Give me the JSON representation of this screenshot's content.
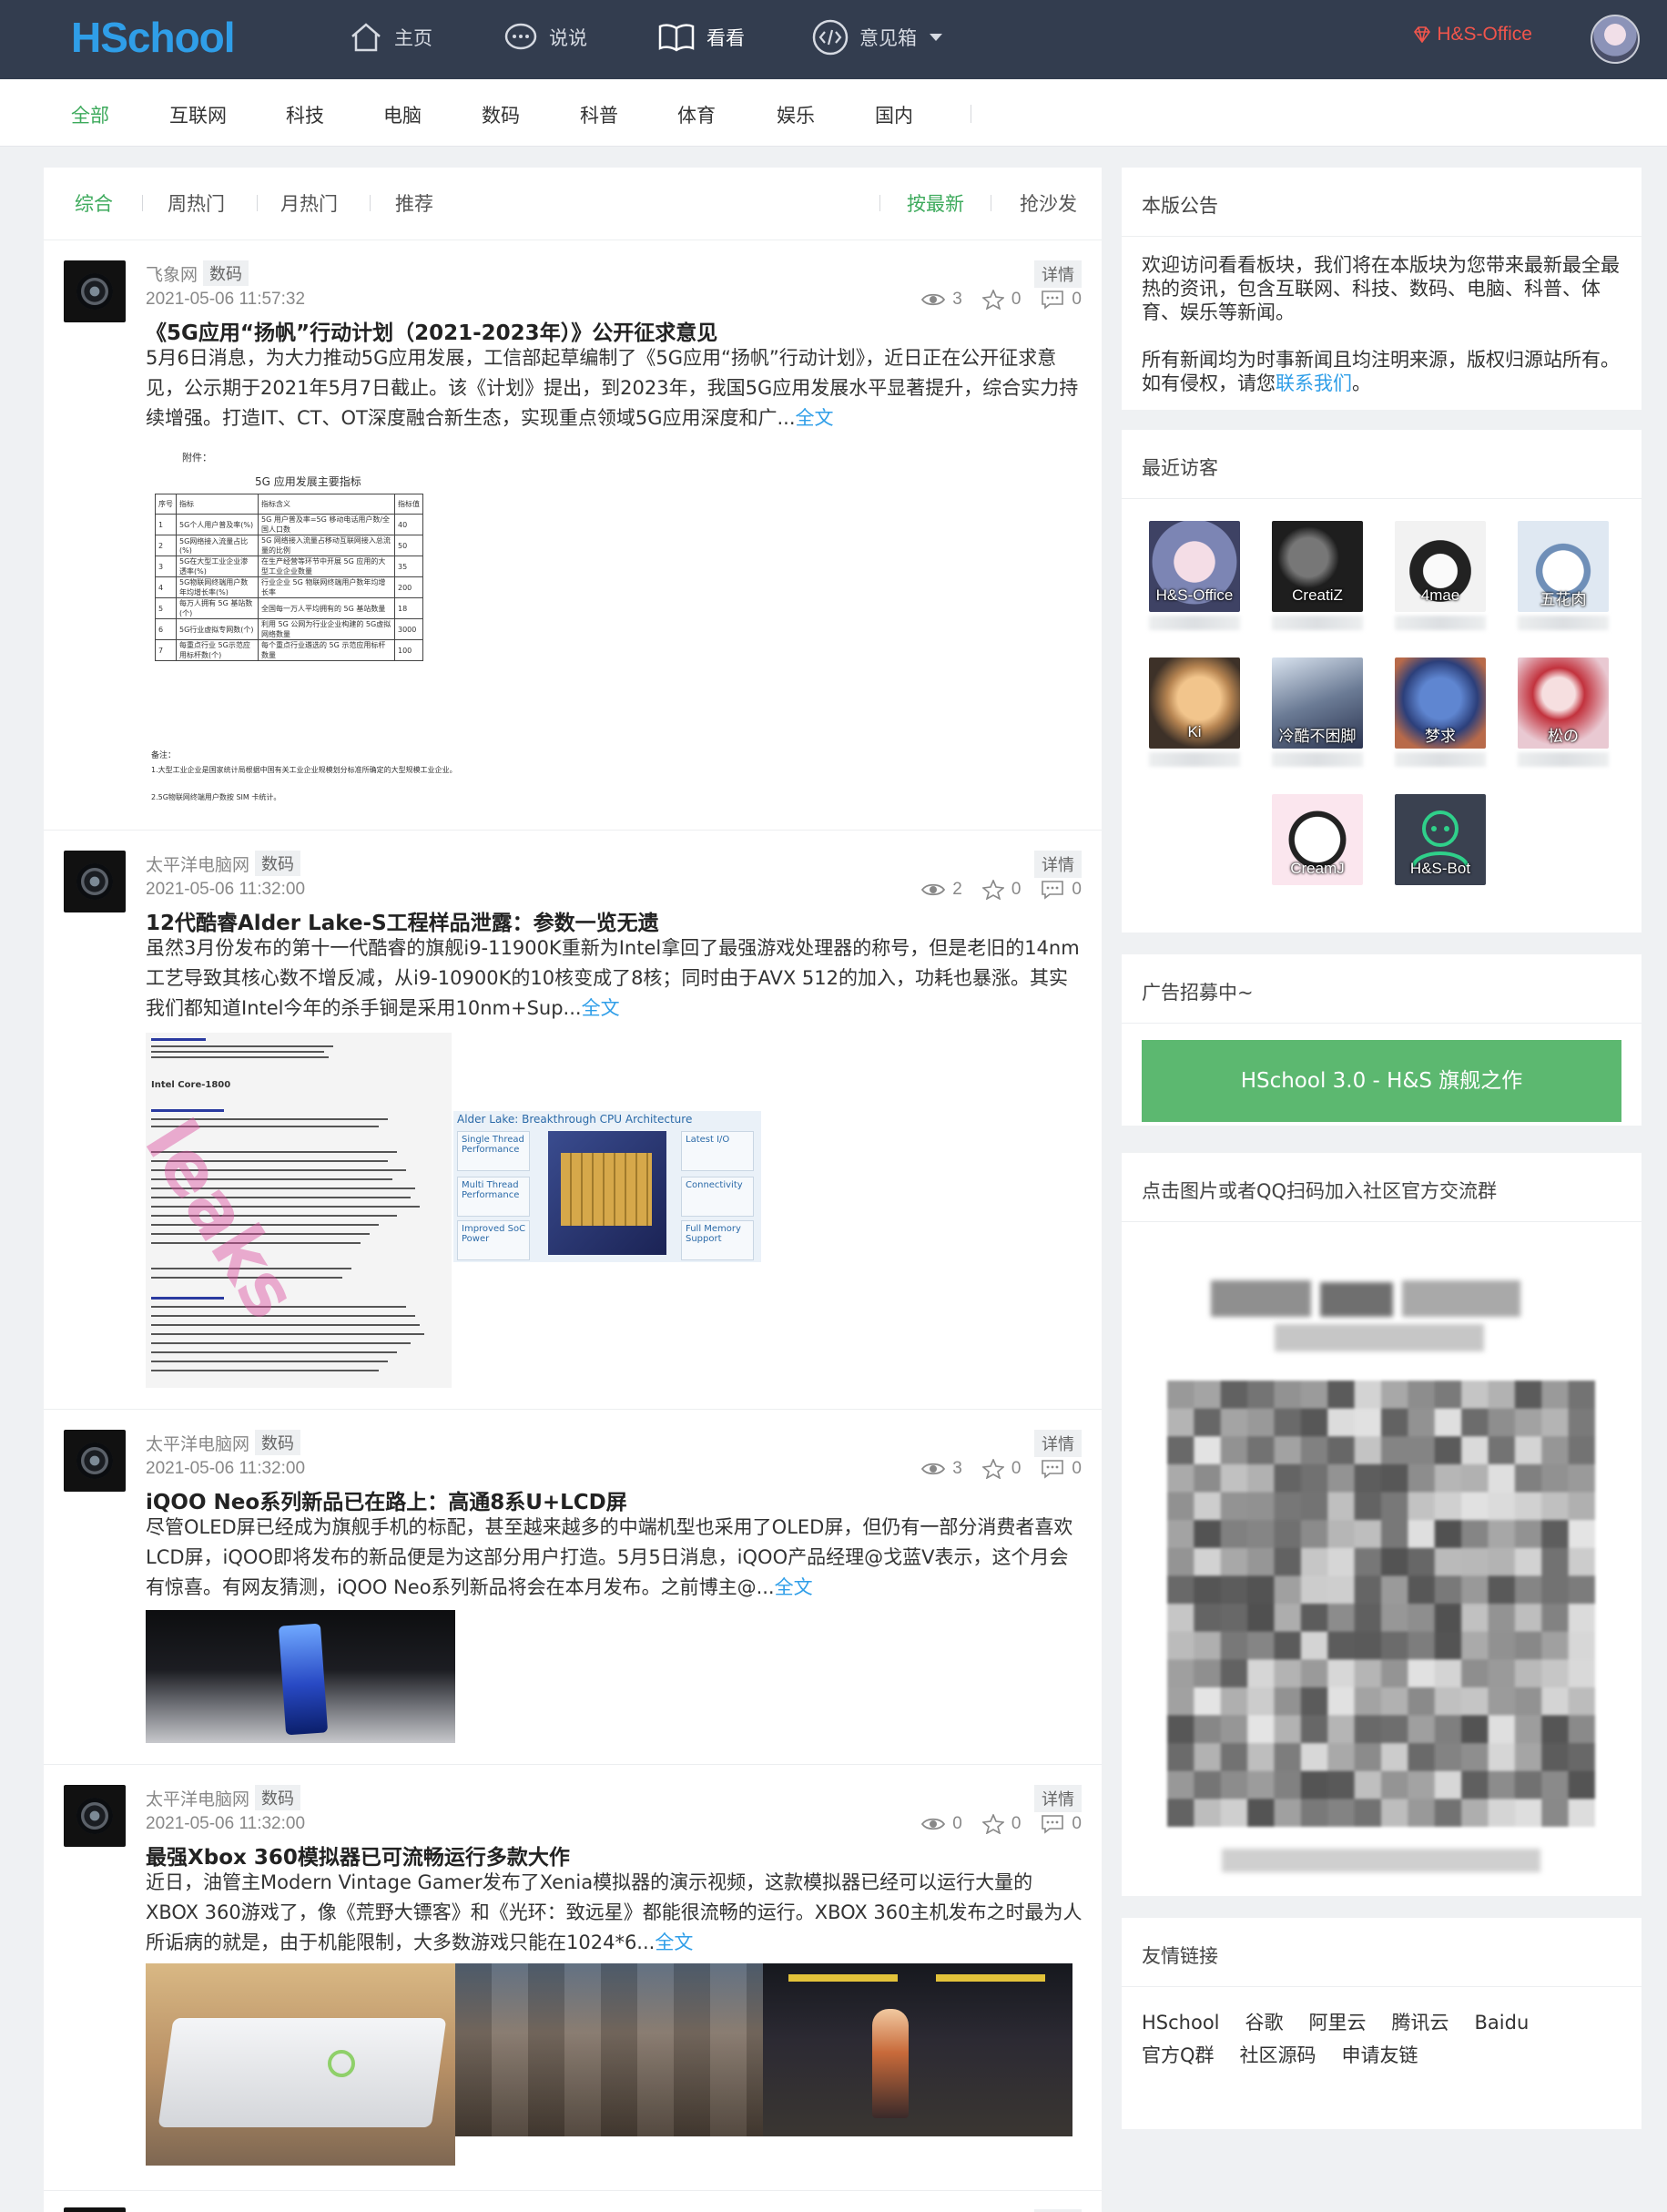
{
  "header": {
    "logo": "HSchool",
    "nav": [
      {
        "label": "主页",
        "icon": "home-icon"
      },
      {
        "label": "说说",
        "icon": "chat-bubble-icon"
      },
      {
        "label": "看看",
        "icon": "book-icon"
      },
      {
        "label": "意见箱",
        "icon": "code-icon"
      }
    ],
    "user_name": "H&S-Office"
  },
  "categories": [
    "全部",
    "互联网",
    "科技",
    "电脑",
    "数码",
    "科普",
    "体育",
    "娱乐",
    "国内"
  ],
  "tabs": {
    "left": [
      "综合",
      "周热门",
      "月热门",
      "推荐"
    ],
    "right": [
      "按最新",
      "抢沙发"
    ]
  },
  "posts": [
    {
      "source": "飞象网",
      "tag": "数码",
      "date": "2021-05-06 11:57:32",
      "detail": "详情",
      "views": "3",
      "stars": "0",
      "comments": "0",
      "title": "《5G应用“扬帆”行动计划（2021-2023年）》公开征求意见",
      "body": "5月6日消息，为大力推动5G应用发展，工信部起草编制了《5G应用“扬帆”行动计划》，近日正在公开征求意见，公示期于2021年5月7日截止。该《计划》提出，到2023年，我国5G应用发展水平显著提升，综合实力持续增强。打造IT、CT、OT深度融合新生态，实现重点领域5G应用深度和广...",
      "more": "全文",
      "image_caption": "附件：",
      "image_title": "5G 应用发展主要指标",
      "table_header": [
        "序号",
        "指标",
        "指标含义",
        "指标值"
      ],
      "table_rows": [
        [
          "1",
          "5G个人用户普及率(%)",
          "5G 用户普及率=5G 移动电话用户数/全国人口数",
          "40"
        ],
        [
          "2",
          "5G网络接入流量占比(%)",
          "5G 网络接入流量占移动互联网接入总流量的比例",
          "50"
        ],
        [
          "3",
          "5G在大型工业企业渗透率(%)",
          "在生产经营等环节中开展 5G 应用的大型工业企业数量",
          "35"
        ],
        [
          "4",
          "5G物联网终端用户数年均增长率(%)",
          "行业企业 5G 物联网终端用户数年均增长率",
          "200"
        ],
        [
          "5",
          "每万人拥有 5G 基站数(个)",
          "全国每一万人平均拥有的 5G 基站数量",
          "18"
        ],
        [
          "6",
          "5G行业虚拟专网数(个)",
          "利用 5G 公网为行业企业构建的 5G虚拟网络数量",
          "3000"
        ],
        [
          "7",
          "每重点行业 5G示范应用标杆数(个)",
          "每个重点行业遴选的 5G 示范应用标杆数量",
          "100"
        ]
      ],
      "notes": [
        "备注：",
        "1.大型工业企业是国家统计局根据中国有关工业企业规模划分标准所确定的大型规模工业企业。",
        "2.5G物联网终端用户数按 SIM 卡统计。"
      ]
    },
    {
      "source": "太平洋电脑网",
      "tag": "数码",
      "date": "2021-05-06 11:32:00",
      "detail": "详情",
      "views": "2",
      "stars": "0",
      "comments": "0",
      "title": "12代酷睿Alder Lake-S工程样品泄露：参数一览无遗",
      "body": "虽然3月份发布的第十一代酷睿的旗舰i9-11900K重新为Intel拿回了最强游戏处理器的称号，但是老旧的14nm工艺导致其核心数不增反减，从i9-10900K的10核变成了8核；同时由于AVX 512的加入，功耗也暴涨。其实我们都知道Intel今年的杀手锏是采用10nm+Sup...",
      "more": "全文",
      "image_label": "Intel Core-1800",
      "image2_title": "Alder Lake: Breakthrough CPU Architecture",
      "image2_boxes": [
        "Single Thread Performance",
        "Multi Thread Performance",
        "Improved SoC Power",
        "Latest I/O",
        "Connectivity",
        "Full Memory Support"
      ]
    },
    {
      "source": "太平洋电脑网",
      "tag": "数码",
      "date": "2021-05-06 11:32:00",
      "detail": "详情",
      "views": "3",
      "stars": "0",
      "comments": "0",
      "title": "iQOO Neo系列新品已在路上：高通8系U+LCD屏",
      "body": "尽管OLED屏已经成为旗舰手机的标配，甚至越来越多的中端机型也采用了OLED屏，但仍有一部分消费者喜欢LCD屏，iQOO即将发布的新品便是为这部分用户打造。5月5日消息，iQOO产品经理@戈蓝V表示，这个月会有惊喜。有网友猜测，iQOO Neo系列新品将会在本月发布。之前博主@...",
      "more": "全文"
    },
    {
      "source": "太平洋电脑网",
      "tag": "数码",
      "date": "2021-05-06 11:32:00",
      "detail": "详情",
      "views": "0",
      "stars": "0",
      "comments": "0",
      "title": "最强Xbox 360模拟器已可流畅运行多款大作",
      "body": "近日，油管主Modern Vintage Gamer发布了Xenia模拟器的演示视频，这款模拟器已经可以运行大量的XBOX 360游戏了，像《荒野大镖客》和《光环：致远星》都能很流畅的运行。XBOX 360主机发布之时最为人所诟病的就是，由于机能限制，大多数游戏只能在1024*6...",
      "more": "全文"
    }
  ],
  "sidebar": {
    "notice": {
      "title": "本版公告",
      "p1": "欢迎访问看看板块，我们将在本版块为您带来最新最全最热的资讯，包含互联网、科技、数码、电脑、科普、体育、娱乐等新闻。",
      "p2_before": "所有新闻均为时事新闻且均注明来源，版权归源站所有。如有侵权，请您",
      "p2_link": "联系我们",
      "p2_after": "。"
    },
    "visitors": {
      "title": "最近访客",
      "list": [
        "H&S-Office",
        "CreatiZ",
        "4mae",
        "五花肉",
        "Ki",
        "冷酷不困脚",
        "梦求",
        "松の",
        "CreamJ",
        "H&S-Bot"
      ]
    },
    "ad": {
      "title": "广告招募中~",
      "button": "HSchool 3.0 - H&S 旗舰之作"
    },
    "qq": {
      "title": "点击图片或者QQ扫码加入社区官方交流群"
    },
    "links": {
      "title": "友情链接",
      "items": [
        "HSchool",
        "谷歌",
        "阿里云",
        "腾讯云",
        "Baidu",
        "官方Q群",
        "社区源码"
      ],
      "apply": "申请友链"
    }
  },
  "colors": {
    "nav_bg": "#333d4f",
    "accent_green": "#3daa5c",
    "link_blue": "#2f9ee8",
    "user_red": "#f0554c"
  }
}
